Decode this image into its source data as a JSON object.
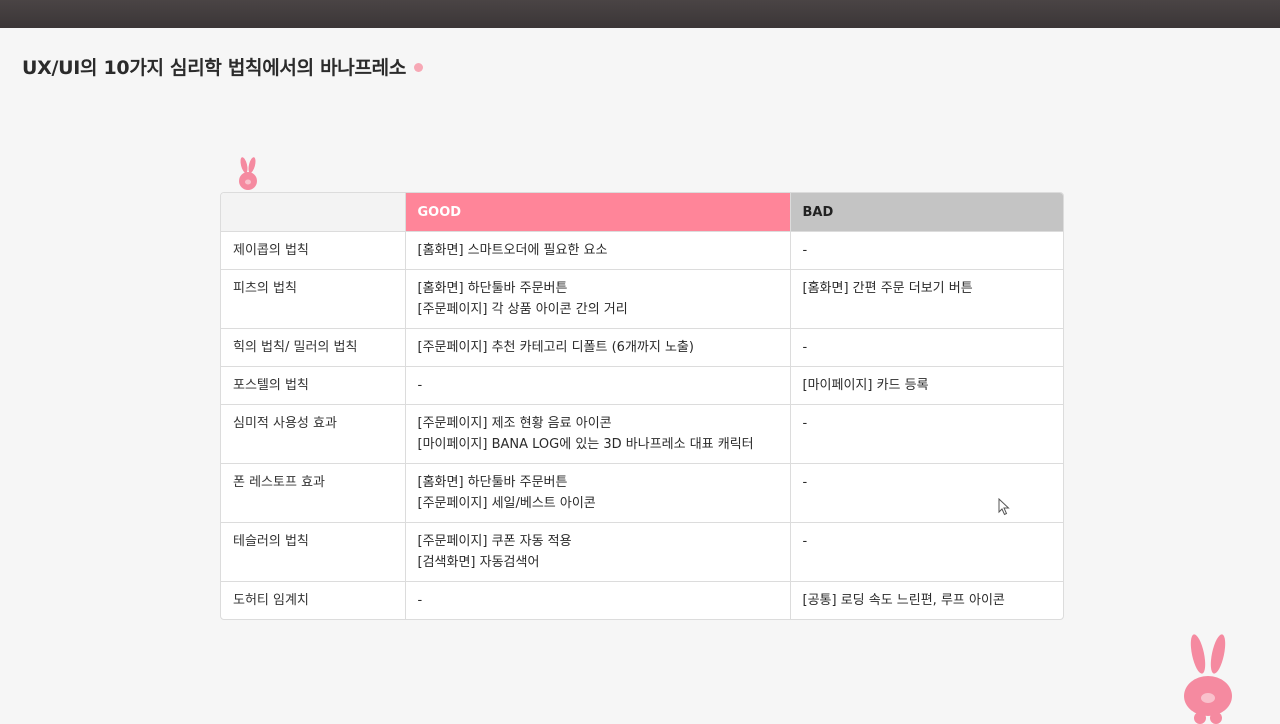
{
  "page": {
    "title": "UX/UI의 10가지 심리학 법칙에서의 바나프레소"
  },
  "colors": {
    "good_header": "#ff8599",
    "bad_header": "#c4c4c4",
    "accent_pink": "#f7a8b5"
  },
  "table": {
    "headers": [
      "",
      "GOOD",
      "BAD"
    ],
    "rows": [
      {
        "law": "제이콥의 법칙",
        "good": [
          "[홈화면] 스마트오더에 필요한 요소"
        ],
        "bad": [
          "-"
        ]
      },
      {
        "law": "피츠의 법칙",
        "good": [
          "[홈화면] 하단툴바 주문버튼",
          "[주문페이지] 각 상품 아이콘 간의 거리"
        ],
        "bad": [
          "[홈화면] 간편 주문 더보기 버튼"
        ]
      },
      {
        "law": "힉의 법칙/ 밀러의 법칙",
        "good": [
          "[주문페이지] 추천 카테고리 디폴트 (6개까지 노출)"
        ],
        "bad": [
          "-"
        ]
      },
      {
        "law": "포스텔의 법칙",
        "good": [
          "-"
        ],
        "bad": [
          "[마이페이지] 카드 등록"
        ]
      },
      {
        "law": "심미적 사용성 효과",
        "good": [
          "[주문페이지] 제조 현황 음료 아이콘",
          "[마이페이지] BANA LOG에 있는 3D 바나프레소 대표 캐릭터"
        ],
        "bad": [
          "-"
        ]
      },
      {
        "law": "폰 레스토프 효과",
        "good": [
          "[홈화면] 하단툴바 주문버튼",
          "[주문페이지] 세일/베스트 아이콘"
        ],
        "bad": [
          "-"
        ]
      },
      {
        "law": "테슬러의 법칙",
        "good": [
          "[주문페이지] 쿠폰 자동 적용",
          "[검색화면] 자동검색어"
        ],
        "bad": [
          "-"
        ]
      },
      {
        "law": "도허티 임계치",
        "good": [
          "-"
        ],
        "bad": [
          "[공통] 로딩 속도 느린편, 루프 아이콘"
        ]
      }
    ]
  }
}
